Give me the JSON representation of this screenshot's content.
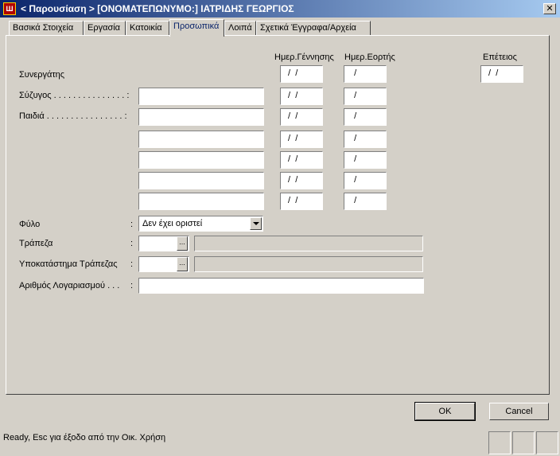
{
  "window": {
    "icon_text": "Ш",
    "title": "< Παρουσίαση > [ΟΝΟΜΑΤΕΠΩΝΥΜΟ:] ΙΑΤΡΙΔΗΣ ΓΕΩΡΓΙΟΣ",
    "close_label": "✕"
  },
  "tabs": [
    {
      "label": "Βασικά Στοιχεία"
    },
    {
      "label": "Εργασία"
    },
    {
      "label": "Κατοικία"
    },
    {
      "label": "Προσωπικά",
      "active": true
    },
    {
      "label": "Λοιπά"
    },
    {
      "label": "Σχετικά Έγγραφα/Αρχεία"
    }
  ],
  "columns": {
    "birth": "Ημερ.Γέννησης",
    "nameday": "Ημερ.Εορτής",
    "anniversary": "Επέτειος"
  },
  "labels": {
    "partner": "Συνεργάτης",
    "spouse": "Σύζυγος . . . . . . . . . . . . . . . :",
    "children": "Παιδιά . . . . . . . . . . . . . . . . :",
    "gender": "Φύλο",
    "bank": "Τράπεζα",
    "branch": "Υποκατάστημα Τράπεζας",
    "account": "Αριθμός Λογαριασμού . . ."
  },
  "colon": ":",
  "date_placeholder_birth": " /  /",
  "date_placeholder_nameday": "  /",
  "gender_select": {
    "value": "Δεν έχει οριστεί"
  },
  "ellipsis": "...",
  "buttons": {
    "ok": "OK",
    "cancel": "Cancel"
  },
  "status": {
    "text": "Ready, Esc για έξοδο από την Οικ. Χρήση"
  }
}
